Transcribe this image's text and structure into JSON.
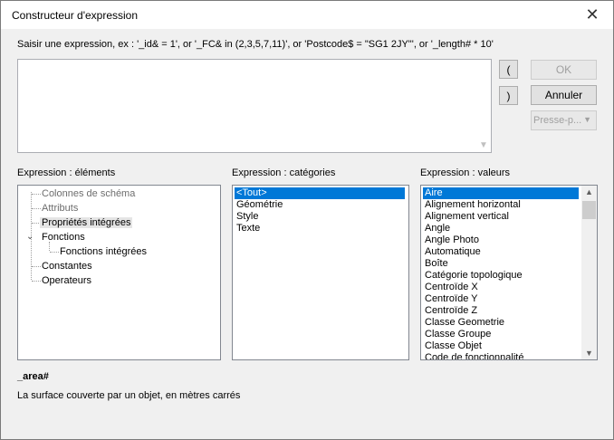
{
  "window": {
    "title": "Constructeur d'expression",
    "close_glyph": "✕"
  },
  "hint": "Saisir une expression, ex : '_id& = 1', or '_FC& in (2,3,5,7,11)', or 'Postcode$ = \"SG1 2JY\"', or '_length# * 10'",
  "editor": {
    "value": ""
  },
  "paren_buttons": {
    "open": "(",
    "close": ")"
  },
  "buttons": {
    "ok": "OK",
    "cancel": "Annuler",
    "clipboard": "Presse-p..."
  },
  "elements": {
    "header": "Expression : éléments",
    "items": [
      {
        "label": "Colonnes de schéma",
        "state": "disabled"
      },
      {
        "label": "Attributs",
        "state": "disabled"
      },
      {
        "label": "Propriétés intégrées",
        "state": "selected"
      },
      {
        "label": "Fonctions",
        "state": "expanded"
      },
      {
        "label": "Fonctions intégrées",
        "state": "child"
      },
      {
        "label": "Constantes",
        "state": "normal"
      },
      {
        "label": "Operateurs",
        "state": "normal"
      }
    ]
  },
  "categories": {
    "header": "Expression : catégories",
    "items": [
      "<Tout>",
      "Géométrie",
      "Style",
      "Texte"
    ],
    "selected_index": 0
  },
  "values": {
    "header": "Expression : valeurs",
    "items": [
      "Aire",
      "Alignement horizontal",
      "Alignement vertical",
      "Angle",
      "Angle Photo",
      "Automatique",
      "Boîte",
      "Catégorie topologique",
      "Centroïde X",
      "Centroïde Y",
      "Centroïde Z",
      "Classe Geometrie",
      "Classe Groupe",
      "Classe Objet",
      "Code de fonctionnalité"
    ],
    "selected_index": 0
  },
  "description": {
    "name": "_area#",
    "text": "La surface couverte par un objet, en mètres carrés"
  },
  "colors": {
    "selection": "#0078d7",
    "dialog_bg": "#f0f0f0"
  }
}
